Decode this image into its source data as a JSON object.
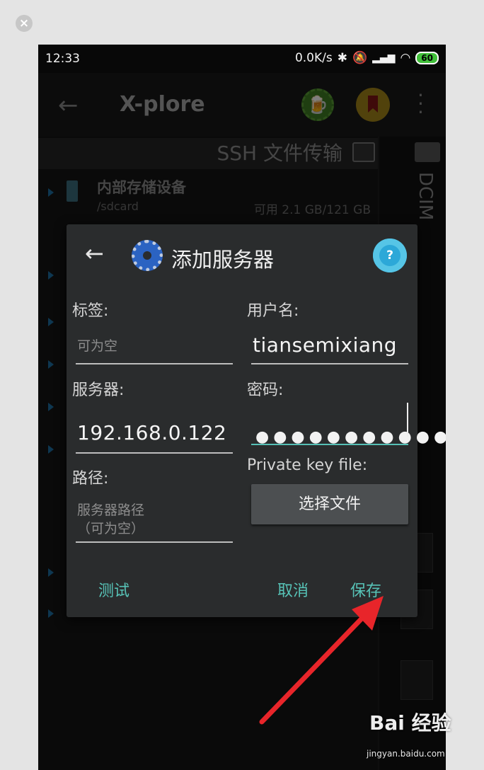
{
  "status": {
    "time": "12:33",
    "speed": "0.0K/s",
    "battery": "60"
  },
  "app": {
    "title": "X-plore"
  },
  "left_pane": {
    "ssh_label": "SSH 文件传输",
    "storage_name": "内部存储设备",
    "storage_path": "/sdcard",
    "storage_usage": "可用 2.1 GB/121 GB"
  },
  "right_pane": {
    "folder": "DCIM"
  },
  "dialog": {
    "title": "添加服务器",
    "help_icon": "?",
    "label_tag": "标签:",
    "tag_placeholder": "可为空",
    "label_username": "用户名:",
    "username_value": "tiansemixiang",
    "label_server": "服务器:",
    "server_value": "192.168.0.122",
    "label_password": "密码:",
    "password_mask": "●●●●●●●●●●●",
    "label_path": "路径:",
    "path_placeholder_line1": "服务器路径",
    "path_placeholder_line2": "（可为空）",
    "label_private_key": "Private key file:",
    "choose_file_button": "选择文件",
    "test_button": "测试",
    "cancel_button": "取消",
    "save_button": "保存"
  },
  "colors": {
    "accent": "#57c3b7",
    "dialog_bg": "#2a2c2d",
    "arrow": "#e8252a"
  },
  "watermark": {
    "brand": "Bai 经验",
    "url": "jingyan.baidu.com"
  }
}
